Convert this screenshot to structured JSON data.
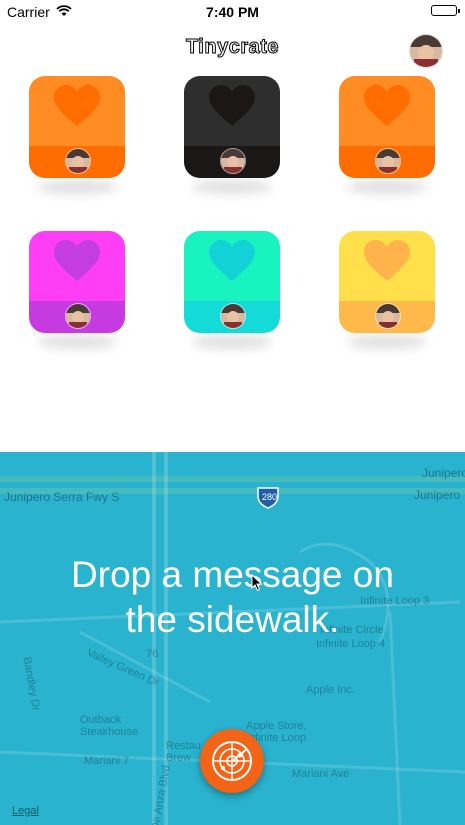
{
  "status_bar": {
    "carrier": "Carrier",
    "time": "7:40 PM"
  },
  "nav": {
    "title": "Tinycrate"
  },
  "crates": [
    {
      "top": "#ff8c22",
      "bottom": "#ff6d00",
      "heart": "#ff6c00"
    },
    {
      "top": "#2e2e2e",
      "bottom": "#1a1717",
      "heart": "#1b1717"
    },
    {
      "top": "#ff8c22",
      "bottom": "#ff6d00",
      "heart": "#ff6c00"
    },
    {
      "top": "#ff3df5",
      "bottom": "#c53be0",
      "heart": "#c43ddf"
    },
    {
      "top": "#19f3bf",
      "bottom": "#14dbd8",
      "heart": "#12d2d6"
    },
    {
      "top": "#ffe04a",
      "bottom": "#ffb84a",
      "heart": "#ffb34a"
    }
  ],
  "map": {
    "headline_line1": "Drop a message on",
    "headline_line2": "the sidewalk.",
    "legal": "Legal",
    "labels": {
      "junipero_1": "Junipero",
      "junipero_2": "Junipero",
      "junipero_serra": "Junipero Serra Fwy S",
      "hwy": "280",
      "valley_green": "Valley Green Dr",
      "bandley": "Bandley Dr",
      "outback": "Outback Steakhouse",
      "infinite_loop_3": "Infinite Loop 3",
      "infinite_loop_4": "Infinite Loop 4",
      "infinite_circle": "Infinite Circle",
      "apple_inc": "Apple Inc.",
      "apple_store": "Apple Store, Infinite Loop",
      "mariani": "Mariani Ave",
      "de_anza": "De Anza Blvd",
      "route76": "76",
      "restau": "Restau Brew",
      "mariani7": "Mariani 7"
    },
    "accent": "#f36417",
    "water": "#2ab3cf"
  },
  "icons": {
    "radar": "radar-icon",
    "heart": "heart-icon",
    "wifi": "wifi-icon",
    "battery": "battery-icon"
  }
}
